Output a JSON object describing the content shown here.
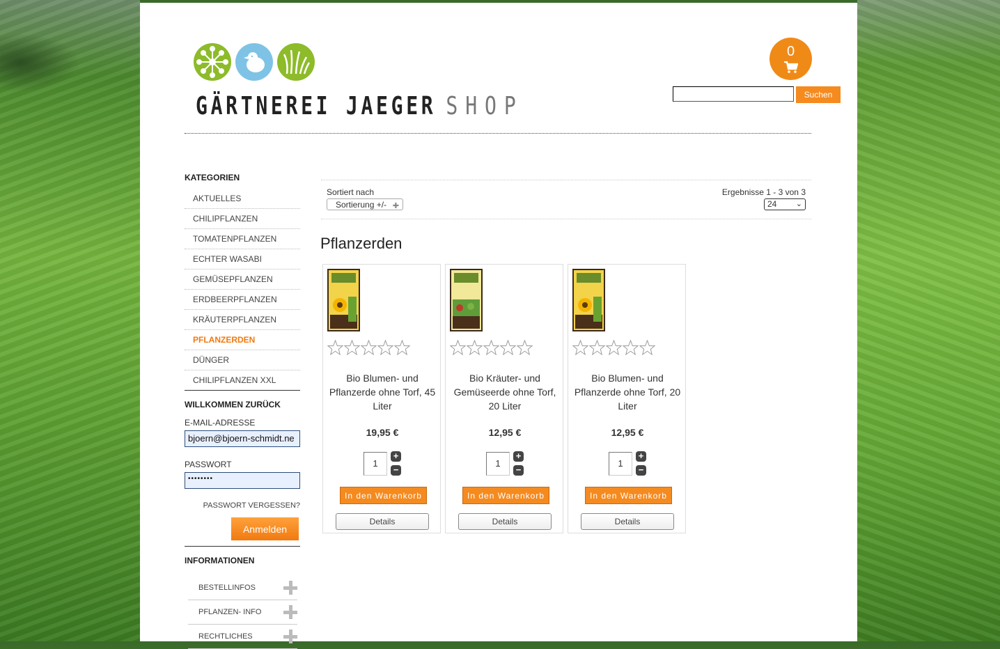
{
  "header": {
    "logo_text_main": "GÄRTNEREI JAEGER",
    "logo_text_shop": "SHOP",
    "cart_count": "0",
    "search_value": "",
    "search_button": "Suchen"
  },
  "sidebar": {
    "categories_heading": "KATEGORIEN",
    "categories": [
      "AKTUELLES",
      "CHILIPFLANZEN",
      "TOMATENPFLANZEN",
      "ECHTER WASABI",
      "GEMÜSEPFLANZEN",
      "ERDBEERPFLANZEN",
      "KRÄUTERPFLANZEN",
      "PFLANZERDEN",
      "DÜNGER",
      "CHILIPFLANZEN XXL"
    ],
    "active_category": "PFLANZERDEN",
    "login": {
      "heading": "WILLKOMMEN ZURÜCK",
      "email_label": "E-MAIL-ADRESSE",
      "email_value": "bjoern@bjoern-schmidt.ne",
      "password_label": "PASSWORT",
      "password_value": "••••••••",
      "forgot": "PASSWORT VERGESSEN?",
      "submit": "Anmelden"
    },
    "info_heading": "INFORMATIONEN",
    "info_items": [
      "BESTELLINFOS",
      "PFLANZEN- INFO",
      "RECHTLICHES"
    ]
  },
  "toolbar": {
    "sort_label": "Sortiert nach",
    "sort_value": "Sortierung +/-",
    "results": "Ergebnisse 1 - 3 von 3",
    "per_page": "24"
  },
  "category_title": "Pflanzerden",
  "products": [
    {
      "name": "Bio Blumen- und Pflanzerde ohne Torf, 45 Liter",
      "price": "19,95 €",
      "qty": "1",
      "rating": 0,
      "cart_button": "In den Warenkorb",
      "details_button": "Details",
      "image": "sunflower-soil-bag"
    },
    {
      "name": "Bio Kräuter- und Gemüseerde ohne Torf, 20 Liter",
      "price": "12,95 €",
      "qty": "1",
      "rating": 0,
      "cart_button": "In den Warenkorb",
      "details_button": "Details",
      "image": "herb-soil-bag"
    },
    {
      "name": "Bio Blumen- und Pflanzerde ohne Torf, 20 Liter",
      "price": "12,95 €",
      "qty": "1",
      "rating": 0,
      "cart_button": "In den Warenkorb",
      "details_button": "Details",
      "image": "sunflower-soil-bag"
    }
  ],
  "colors": {
    "accent": "#f58a1f",
    "logo_green": "#8dbb2a",
    "logo_blue": "#7ec3e6"
  }
}
